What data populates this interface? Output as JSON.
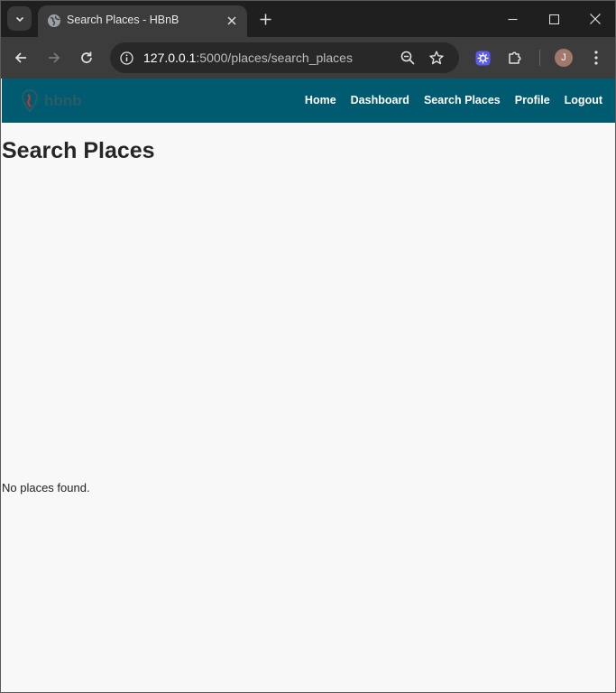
{
  "browser": {
    "tab_title": "Search Places - HBnB",
    "url_host": "127.0.0.1",
    "url_path": ":5000/places/search_places",
    "profile_initial": "J"
  },
  "site": {
    "logo_text": "hbnb",
    "nav": [
      {
        "label": "Home"
      },
      {
        "label": "Dashboard"
      },
      {
        "label": "Search Places"
      },
      {
        "label": "Profile"
      },
      {
        "label": "Logout"
      }
    ]
  },
  "main": {
    "title": "Search Places",
    "empty_message": "No places found."
  },
  "colors": {
    "nav_bar": "#005b70",
    "page_bg": "#f8f8f8"
  }
}
